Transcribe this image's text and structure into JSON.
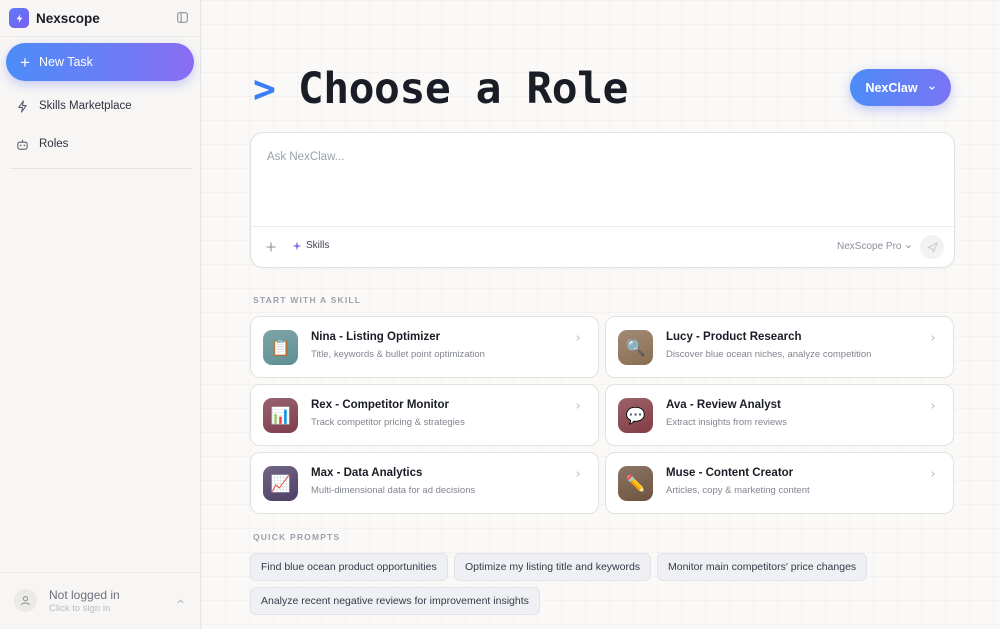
{
  "sidebar": {
    "brand_name": "Nexscope",
    "new_task_label": "New Task",
    "items": [
      {
        "label": "Skills Marketplace",
        "icon": "bolt-icon"
      },
      {
        "label": "Roles",
        "icon": "robot-icon"
      }
    ],
    "user": {
      "name": "Not logged in",
      "subtitle": "Click to sign in"
    }
  },
  "header": {
    "prompt_symbol": ">",
    "title": "Choose a Role",
    "agent_label": "NexClaw"
  },
  "composer": {
    "placeholder": "Ask NexClaw...",
    "skills_label": "Skills",
    "model_label": "NexScope Pro"
  },
  "skills_section": {
    "heading": "START WITH A SKILL",
    "roles": [
      {
        "name": "Nina - Listing Optimizer",
        "description": "Title, keywords & bullet point optimization",
        "icon": "clipboard-icon",
        "glyph": "📋",
        "color": "#5e8f93"
      },
      {
        "name": "Lucy - Product Research",
        "description": "Discover blue ocean niches, analyze competition",
        "icon": "magnifier-icon",
        "glyph": "🔍",
        "color": "#8a6e52"
      },
      {
        "name": "Rex - Competitor Monitor",
        "description": "Track competitor pricing & strategies",
        "icon": "bar-chart-icon",
        "glyph": "📊",
        "color": "#7e3c4d"
      },
      {
        "name": "Ava - Review Analyst",
        "description": "Extract insights from reviews",
        "icon": "speech-bubble-icon",
        "glyph": "💬",
        "color": "#833c45"
      },
      {
        "name": "Max - Data Analytics",
        "description": "Multi-dimensional data for ad decisions",
        "icon": "line-chart-icon",
        "glyph": "📈",
        "color": "#4e3f66"
      },
      {
        "name": "Muse - Content Creator",
        "description": "Articles, copy & marketing content",
        "icon": "pencil-icon",
        "glyph": "✏️",
        "color": "#6e533f"
      }
    ]
  },
  "quick_prompts": {
    "heading": "QUICK PROMPTS",
    "items": [
      "Find blue ocean product opportunities",
      "Optimize my listing title and keywords",
      "Monitor main competitors' price changes",
      "Analyze recent negative reviews for improvement insights"
    ]
  },
  "colors": {
    "accent_start": "#4c8df8",
    "accent_end": "#8b6cf2",
    "prompt_symbol": "#3b7df5"
  }
}
